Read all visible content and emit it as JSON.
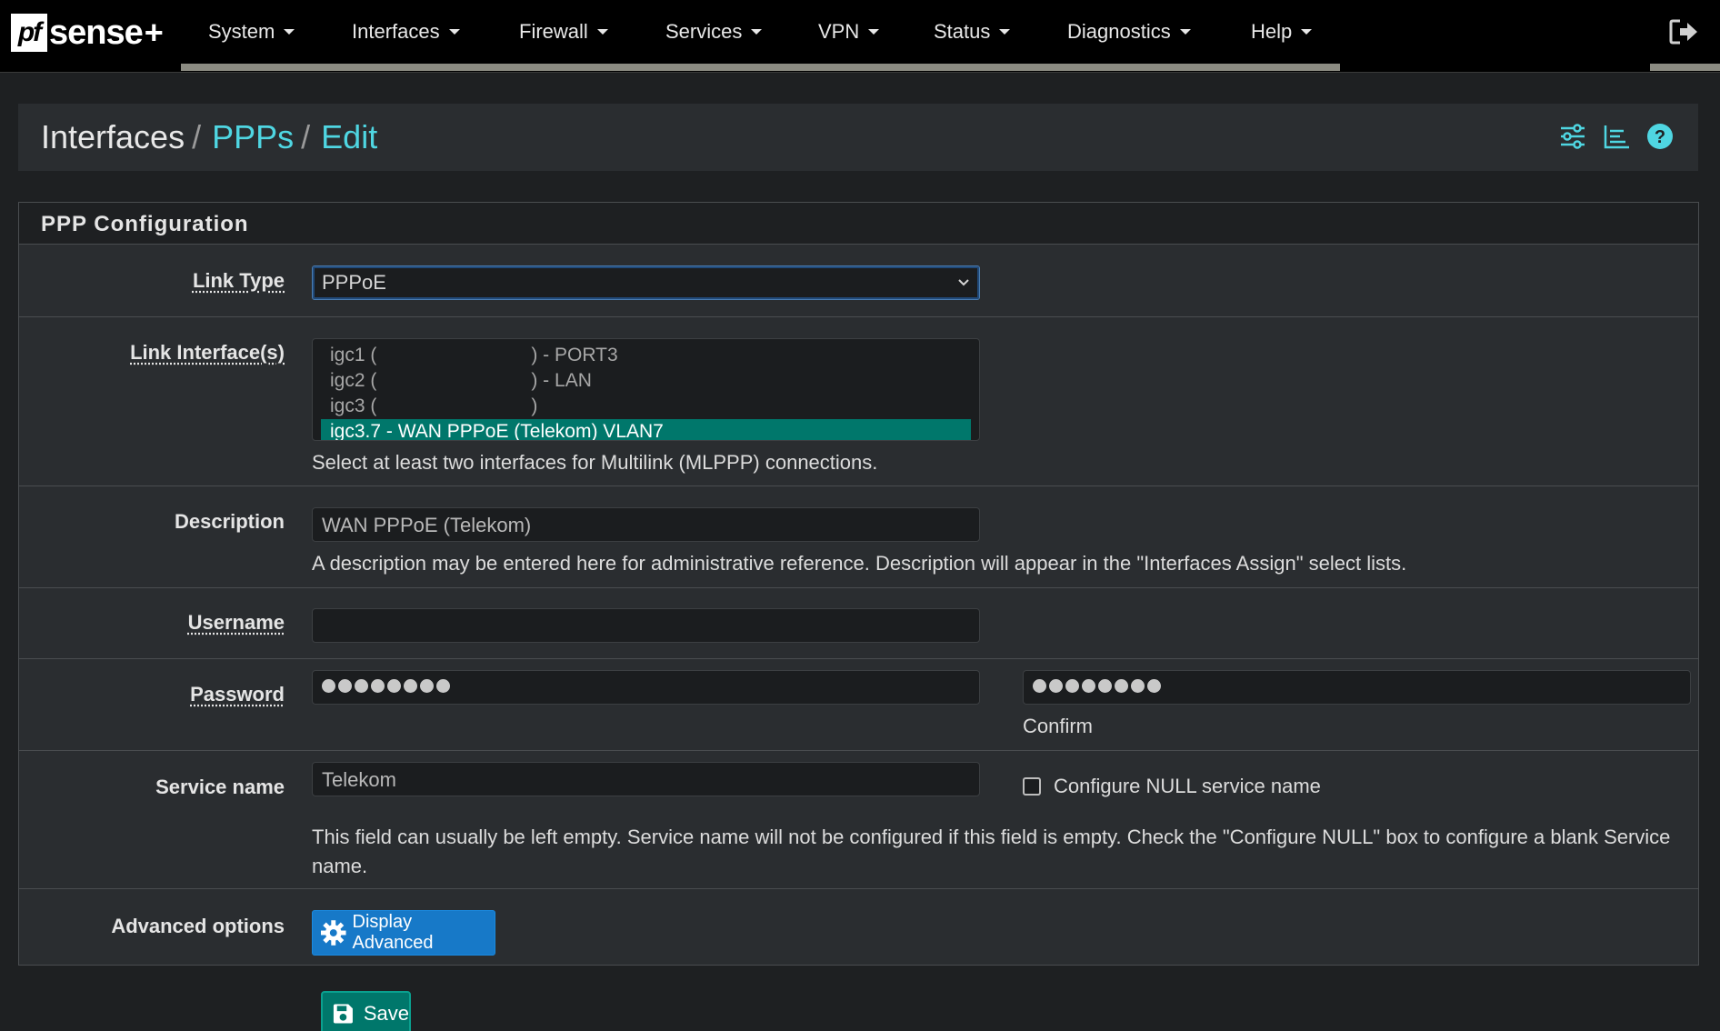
{
  "brand": {
    "name": "sense",
    "badge": "pf",
    "plus": "+"
  },
  "nav": {
    "items": [
      {
        "label": "System"
      },
      {
        "label": "Interfaces"
      },
      {
        "label": "Firewall"
      },
      {
        "label": "Services"
      },
      {
        "label": "VPN"
      },
      {
        "label": "Status"
      },
      {
        "label": "Diagnostics"
      },
      {
        "label": "Help"
      }
    ],
    "logout_icon": "logout-icon"
  },
  "breadcrumb": {
    "root": "Interfaces",
    "sep": "/",
    "level2": "PPPs",
    "level3": "Edit",
    "icons": [
      "sliders-icon",
      "chart-icon",
      "help-icon"
    ]
  },
  "panel": {
    "title": "PPP Configuration",
    "link_type": {
      "label": "Link Type",
      "value": "PPPoE"
    },
    "link_interfaces": {
      "label": "Link Interface(s)",
      "options": [
        {
          "prefix": "igc1 (",
          "suffix": ") - PORT3",
          "selected": false
        },
        {
          "prefix": "igc2 (",
          "suffix": ") - LAN",
          "selected": false
        },
        {
          "prefix": "igc3 (",
          "suffix": ")",
          "selected": false
        },
        {
          "prefix": "igc3.7 - WAN PPPoE (Telekom) VLAN7",
          "suffix": "",
          "selected": true
        }
      ],
      "help": "Select at least two interfaces for Multilink (MLPPP) connections."
    },
    "description": {
      "label": "Description",
      "value": "WAN PPPoE (Telekom)",
      "help": "A description may be entered here for administrative reference. Description will appear in the \"Interfaces Assign\" select lists."
    },
    "username": {
      "label": "Username",
      "value": ""
    },
    "password": {
      "label": "Password",
      "mask_count": 8,
      "confirm_label": "Confirm"
    },
    "service_name": {
      "label": "Service name",
      "value": "Telekom",
      "null_checkbox_label": "Configure NULL service name",
      "null_checked": false,
      "help": "This field can usually be left empty. Service name will not be configured if this field is empty. Check the \"Configure NULL\" box to configure a blank Service name."
    },
    "advanced": {
      "label": "Advanced options",
      "button_label": "Display Advanced"
    }
  },
  "save": {
    "label": "Save"
  },
  "colors": {
    "accent_teal": "#00776b",
    "link_cyan": "#4fd6e2",
    "button_blue": "#1779c8",
    "navbar": "#000000",
    "panel_bg": "#2a2d30"
  }
}
